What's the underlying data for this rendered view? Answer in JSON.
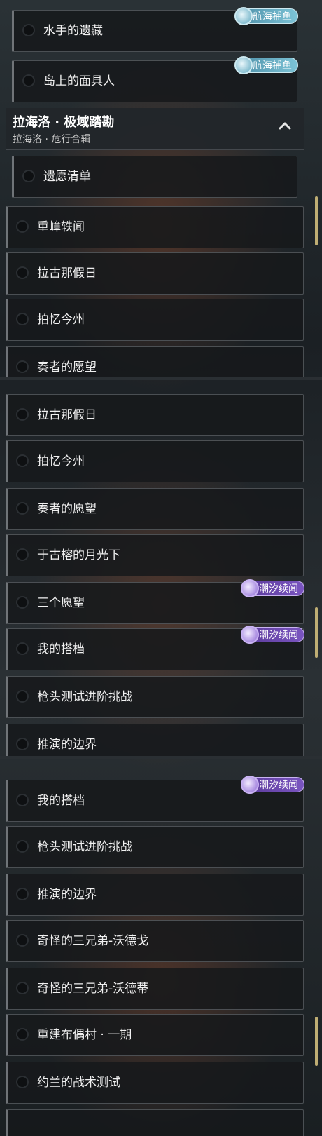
{
  "panel1": {
    "rows_top": [
      {
        "label": "水手的遗藏",
        "badge": "航海捕鱼"
      },
      {
        "label": "岛上的面具人",
        "badge": "航海捕鱼"
      }
    ],
    "header": {
      "title": "拉海洛 · 极域踏勘",
      "subtitle": "拉海洛 · 危行合辑"
    },
    "rows": [
      {
        "label": "遗愿清单"
      },
      {
        "label": "重嶂轶闻"
      },
      {
        "label": "拉古那假日"
      },
      {
        "label": "拍忆今州"
      },
      {
        "label": "奏者的愿望"
      }
    ]
  },
  "panel2": {
    "rows": [
      {
        "label": "拉古那假日"
      },
      {
        "label": "拍忆今州"
      },
      {
        "label": "奏者的愿望"
      },
      {
        "label": "于古榕的月光下"
      },
      {
        "label": "三个愿望",
        "badge": "潮汐续闻"
      },
      {
        "label": "我的搭档",
        "badge": "潮汐续闻"
      },
      {
        "label": "枪头测试进阶挑战"
      },
      {
        "label": "推演的边界"
      }
    ]
  },
  "panel3": {
    "rows": [
      {
        "label": "我的搭档",
        "badge": "潮汐续闻"
      },
      {
        "label": "枪头测试进阶挑战"
      },
      {
        "label": "推演的边界"
      },
      {
        "label": "奇怪的三兄弟-沃德戈"
      },
      {
        "label": "奇怪的三兄弟-沃德蒂"
      },
      {
        "label": "重建布偶村 · 一期"
      },
      {
        "label": "约兰的战术测试"
      }
    ]
  },
  "colors": {
    "fish_badge": "#6fb7cc",
    "tide_badge": "#6b47b0",
    "scrollbar": "#bfae74"
  }
}
